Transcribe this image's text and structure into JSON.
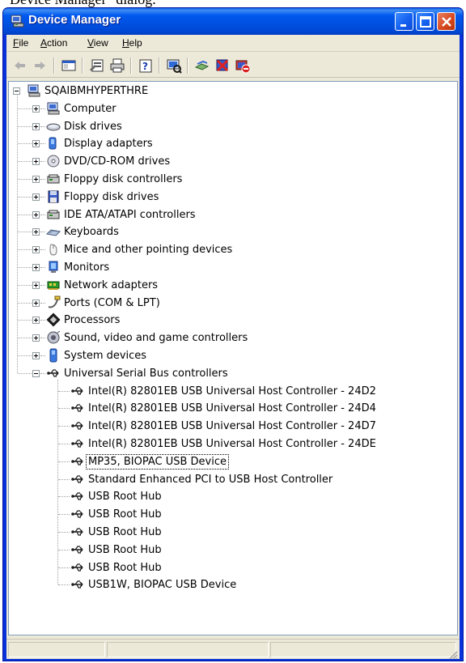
{
  "caption": {
    "text": "Device Manager\" dialog."
  },
  "window": {
    "title": "Device Manager",
    "controls": {
      "minimize": "minimize",
      "maximize": "maximize",
      "close": "close"
    }
  },
  "menu": [
    {
      "label": "File",
      "u": "F",
      "rest": "ile"
    },
    {
      "label": "Action",
      "u": "A",
      "rest": "ction"
    },
    {
      "label": "View",
      "u": "V",
      "rest": "iew"
    },
    {
      "label": "Help",
      "u": "H",
      "rest": "elp"
    }
  ],
  "toolbar_icons": [
    "back-arrow-icon",
    "forward-arrow-icon",
    "show-hide-console-tree-icon",
    "properties-icon",
    "print-icon",
    "help-icon",
    "scan-hardware-changes-icon",
    "update-driver-icon",
    "uninstall-icon",
    "disable-icon"
  ],
  "tree": {
    "root": {
      "label": "SQAIBMHYPERTHRE",
      "icon": "computer-icon"
    },
    "categories": [
      {
        "label": "Computer",
        "icon": "computer-icon"
      },
      {
        "label": "Disk drives",
        "icon": "disk-drive-icon"
      },
      {
        "label": "Display adapters",
        "icon": "display-adapter-icon"
      },
      {
        "label": "DVD/CD-ROM drives",
        "icon": "dvd-drive-icon"
      },
      {
        "label": "Floppy disk controllers",
        "icon": "controller-icon"
      },
      {
        "label": "Floppy disk drives",
        "icon": "floppy-drive-icon"
      },
      {
        "label": "IDE ATA/ATAPI controllers",
        "icon": "controller-icon"
      },
      {
        "label": "Keyboards",
        "icon": "keyboard-icon"
      },
      {
        "label": "Mice and other pointing devices",
        "icon": "mouse-icon"
      },
      {
        "label": "Monitors",
        "icon": "monitor-icon"
      },
      {
        "label": "Network adapters",
        "icon": "network-adapter-icon"
      },
      {
        "label": "Ports (COM & LPT)",
        "icon": "port-icon"
      },
      {
        "label": "Processors",
        "icon": "processor-icon"
      },
      {
        "label": "Sound, video and game controllers",
        "icon": "sound-icon"
      },
      {
        "label": "System devices",
        "icon": "system-device-icon"
      },
      {
        "label": "Universal Serial Bus controllers",
        "icon": "usb-icon",
        "expanded": true
      }
    ],
    "usb_children": [
      {
        "label": "Intel(R) 82801EB USB Universal Host Controller - 24D2"
      },
      {
        "label": "Intel(R) 82801EB USB Universal Host Controller - 24D4"
      },
      {
        "label": "Intel(R) 82801EB USB Universal Host Controller - 24D7"
      },
      {
        "label": "Intel(R) 82801EB USB Universal Host Controller - 24DE"
      },
      {
        "label": "MP35, BIOPAC USB Device",
        "selected": true
      },
      {
        "label": "Standard Enhanced PCI to USB Host Controller"
      },
      {
        "label": "USB Root Hub"
      },
      {
        "label": "USB Root Hub"
      },
      {
        "label": "USB Root Hub"
      },
      {
        "label": "USB Root Hub"
      },
      {
        "label": "USB Root Hub"
      },
      {
        "label": "USB1W, BIOPAC USB Device"
      }
    ]
  },
  "colors": {
    "title_blue": "#0058ee",
    "face": "#ece9d8",
    "selection_outline": "#000000"
  }
}
